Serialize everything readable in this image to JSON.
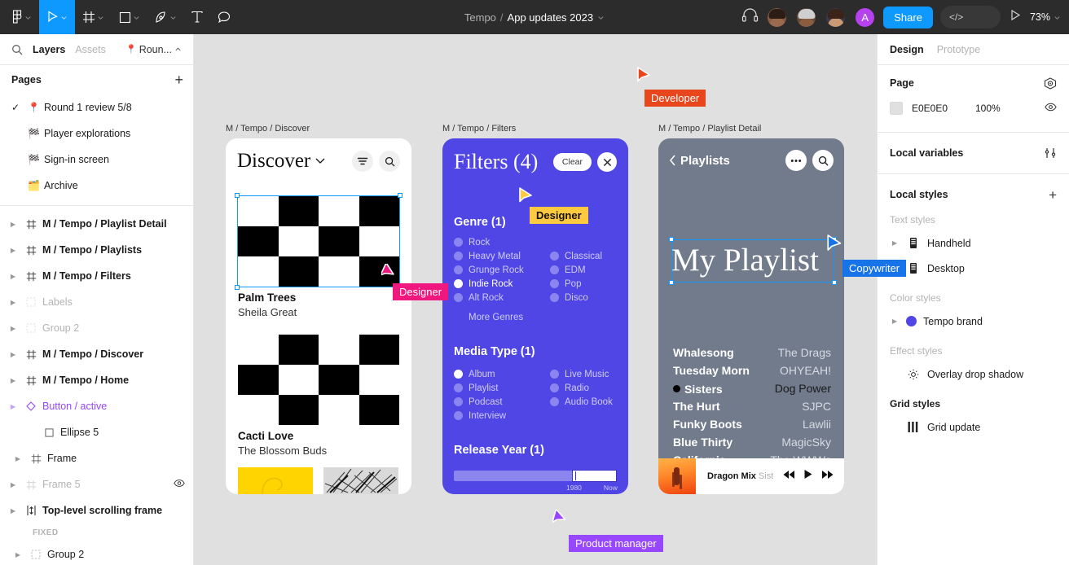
{
  "topbar": {
    "menu_icon": "figma-logo-icon",
    "tools": [
      {
        "name": "move-tool",
        "icon": "cursor-icon",
        "active": true
      },
      {
        "name": "frame-tool",
        "icon": "frame-icon",
        "active": false
      },
      {
        "name": "shape-tool",
        "icon": "square-icon",
        "active": false
      },
      {
        "name": "pen-tool",
        "icon": "pen-icon",
        "active": false
      },
      {
        "name": "text-tool",
        "icon": "text-icon",
        "active": false
      },
      {
        "name": "comment-tool",
        "icon": "comment-icon",
        "active": false
      }
    ],
    "team": "Tempo",
    "separator": "/",
    "file": "App updates 2023",
    "headset_icon": "headset-icon",
    "avatar_initial": "A",
    "share_label": "Share",
    "code_glyph": "</>",
    "present_icon": "play-icon",
    "zoom": "73%"
  },
  "left_panel": {
    "search_icon": "search-icon",
    "tabs": [
      {
        "label": "Layers",
        "active": true
      },
      {
        "label": "Assets",
        "active": false
      }
    ],
    "page_chip": {
      "emoji": "📍",
      "label": "Roun..."
    },
    "pages_header": "Pages",
    "add_page": "+",
    "pages": [
      {
        "check": "✓",
        "emoji": "📍",
        "label": "Round 1 review 5/8"
      },
      {
        "check": "",
        "emoji": "🏁",
        "label": "Player explorations"
      },
      {
        "check": "",
        "emoji": "🏁",
        "label": "Sign-in screen"
      },
      {
        "check": "",
        "emoji": "🗂️",
        "label": "Archive"
      }
    ],
    "layers": [
      {
        "label": "M / Tempo / Playlist Detail",
        "icon": "frame-icon",
        "kind": "frame",
        "indent": 0,
        "twisty": true
      },
      {
        "label": "M / Tempo / Playlists",
        "icon": "frame-icon",
        "kind": "frame",
        "indent": 0,
        "twisty": true
      },
      {
        "label": "M / Tempo / Filters",
        "icon": "frame-icon",
        "kind": "frame",
        "indent": 0,
        "twisty": true
      },
      {
        "label": "Labels",
        "icon": "group-icon",
        "kind": "dim",
        "indent": 0,
        "twisty": true
      },
      {
        "label": "Group 2",
        "icon": "group-icon",
        "kind": "dim",
        "indent": 0,
        "twisty": true
      },
      {
        "label": "M / Tempo / Discover",
        "icon": "frame-icon",
        "kind": "frame",
        "indent": 0,
        "twisty": true
      },
      {
        "label": "M / Tempo / Home",
        "icon": "frame-icon",
        "kind": "frame",
        "indent": 0,
        "twisty": true
      },
      {
        "label": "Button / active",
        "icon": "component-icon",
        "kind": "comp",
        "indent": 0,
        "twisty": true
      },
      {
        "label": "Ellipse 5",
        "icon": "ellipse-icon",
        "kind": "normal",
        "indent": 1,
        "twisty": false
      },
      {
        "label": "Frame",
        "icon": "frame-icon",
        "kind": "normal",
        "indent": 1,
        "twisty": true
      },
      {
        "label": "Frame 5",
        "icon": "frame-icon",
        "kind": "dim",
        "indent": 0,
        "twisty": true,
        "eye": true
      },
      {
        "label": "Top-level scrolling frame",
        "icon": "scroll-icon",
        "kind": "frame",
        "indent": 0,
        "twisty": true
      },
      {
        "label": "FIXED",
        "icon": "",
        "kind": "sublabel",
        "indent": 0,
        "twisty": false
      },
      {
        "label": "Group 2",
        "icon": "group-icon",
        "kind": "normal",
        "indent": 1,
        "twisty": true
      }
    ]
  },
  "canvas": {
    "frames": [
      {
        "name": "discover",
        "label": "M / Tempo / Discover"
      },
      {
        "name": "filters",
        "label": "M / Tempo / Filters"
      },
      {
        "name": "playlist-detail",
        "label": "M / Tempo / Playlist Detail"
      }
    ],
    "discover": {
      "title": "Discover",
      "caret_icon": "chevron-down-icon",
      "filter_icon": "filter-icon",
      "search_icon": "search-icon",
      "cards": [
        {
          "title": "Palm Trees",
          "artist": "Sheila Great"
        },
        {
          "title": "Cacti Love",
          "artist": "The Blossom Buds"
        }
      ]
    },
    "filters": {
      "title": "Filters (4)",
      "clear_label": "Clear",
      "close_icon": "close-icon",
      "genre_header": "Genre (1)",
      "genre_left": [
        {
          "label": "Rock",
          "selected": false
        },
        {
          "label": "Heavy Metal",
          "selected": false
        },
        {
          "label": "Grunge Rock",
          "selected": false
        },
        {
          "label": "Indie Rock",
          "selected": true
        },
        {
          "label": "Alt Rock",
          "selected": false
        },
        {
          "label": "More Genres",
          "selected": false
        }
      ],
      "genre_right": [
        {
          "label": "Classical",
          "selected": false
        },
        {
          "label": "EDM",
          "selected": false
        },
        {
          "label": "Pop",
          "selected": false
        },
        {
          "label": "Disco",
          "selected": false
        }
      ],
      "media_header": "Media Type (1)",
      "media_left": [
        {
          "label": "Album",
          "selected": true
        },
        {
          "label": "Playlist",
          "selected": false
        },
        {
          "label": "Podcast",
          "selected": false
        },
        {
          "label": "Interview",
          "selected": false
        }
      ],
      "media_right": [
        {
          "label": "Live Music",
          "selected": false
        },
        {
          "label": "Radio",
          "selected": false
        },
        {
          "label": "Audio Book",
          "selected": false
        }
      ],
      "year_header": "Release Year (1)",
      "year_min": "1980",
      "year_max": "Now"
    },
    "playlist_detail": {
      "back_label": "Playlists",
      "back_icon": "chevron-left-icon",
      "more_icon": "more-icon",
      "search_icon": "search-icon",
      "big_title": "My Playlist",
      "tracks": [
        {
          "name": "Whalesong",
          "artist": "The Drags",
          "playing": false
        },
        {
          "name": "Tuesday Morn",
          "artist": "OHYEAH!",
          "playing": false
        },
        {
          "name": "Sisters",
          "artist": "Dog Power",
          "playing": true
        },
        {
          "name": "The Hurt",
          "artist": "SJPC",
          "playing": false
        },
        {
          "name": "Funky Boots",
          "artist": "Lawlii",
          "playing": false
        },
        {
          "name": "Blue Thirty",
          "artist": "MagicSky",
          "playing": false
        },
        {
          "name": "California",
          "artist": "The WWWs",
          "playing": false
        }
      ],
      "player": {
        "track": "Dragon Mix",
        "artist": "Sist",
        "prev_icon": "rewind-icon",
        "play_icon": "play-icon",
        "next_icon": "fast-forward-icon"
      }
    },
    "cursors": [
      {
        "name": "Developer",
        "color": "#e8471e"
      },
      {
        "name": "Designer",
        "color": "#f0187f"
      },
      {
        "name": "Designer",
        "color": "#ffc940",
        "text_color": "#111111"
      },
      {
        "name": "Product manager",
        "color": "#9747ff"
      },
      {
        "name": "Copywriter",
        "color": "#1673e8"
      }
    ]
  },
  "right_panel": {
    "tabs": [
      {
        "label": "Design",
        "active": true
      },
      {
        "label": "Prototype",
        "active": false
      }
    ],
    "page_section": {
      "title": "Page",
      "settings_icon": "page-settings-icon",
      "color_hex": "E0E0E0",
      "opacity": "100%",
      "eye_icon": "eye-icon"
    },
    "local_variables": {
      "title": "Local variables",
      "icon": "sliders-icon"
    },
    "local_styles": {
      "title": "Local styles",
      "add_icon": "+"
    },
    "groups": [
      {
        "title": "Text styles",
        "bold": false,
        "items": [
          {
            "label": "Handheld",
            "icon": "text-style-icon",
            "twisty": true
          },
          {
            "label": "Desktop",
            "icon": "text-style-icon",
            "twisty": true
          }
        ]
      },
      {
        "title": "Color styles",
        "bold": false,
        "items": [
          {
            "label": "Tempo brand",
            "icon": "color-style-icon",
            "twisty": true
          }
        ]
      },
      {
        "title": "Effect styles",
        "bold": false,
        "items": [
          {
            "label": "Overlay drop shadow",
            "icon": "effect-icon",
            "twisty": false
          }
        ]
      },
      {
        "title": "Grid styles",
        "bold": true,
        "items": [
          {
            "label": "Grid update",
            "icon": "grid-icon",
            "twisty": false
          }
        ]
      }
    ]
  }
}
